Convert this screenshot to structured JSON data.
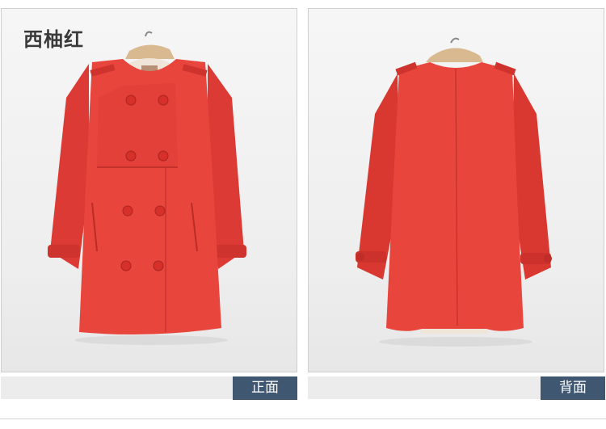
{
  "header": {
    "color_name": "西柚红"
  },
  "views": [
    {
      "label": "正面"
    },
    {
      "label": "背面"
    }
  ],
  "colors": {
    "coat": "#e8453c",
    "tag_bg": "#3f5770",
    "bar_bg": "#ececec"
  }
}
